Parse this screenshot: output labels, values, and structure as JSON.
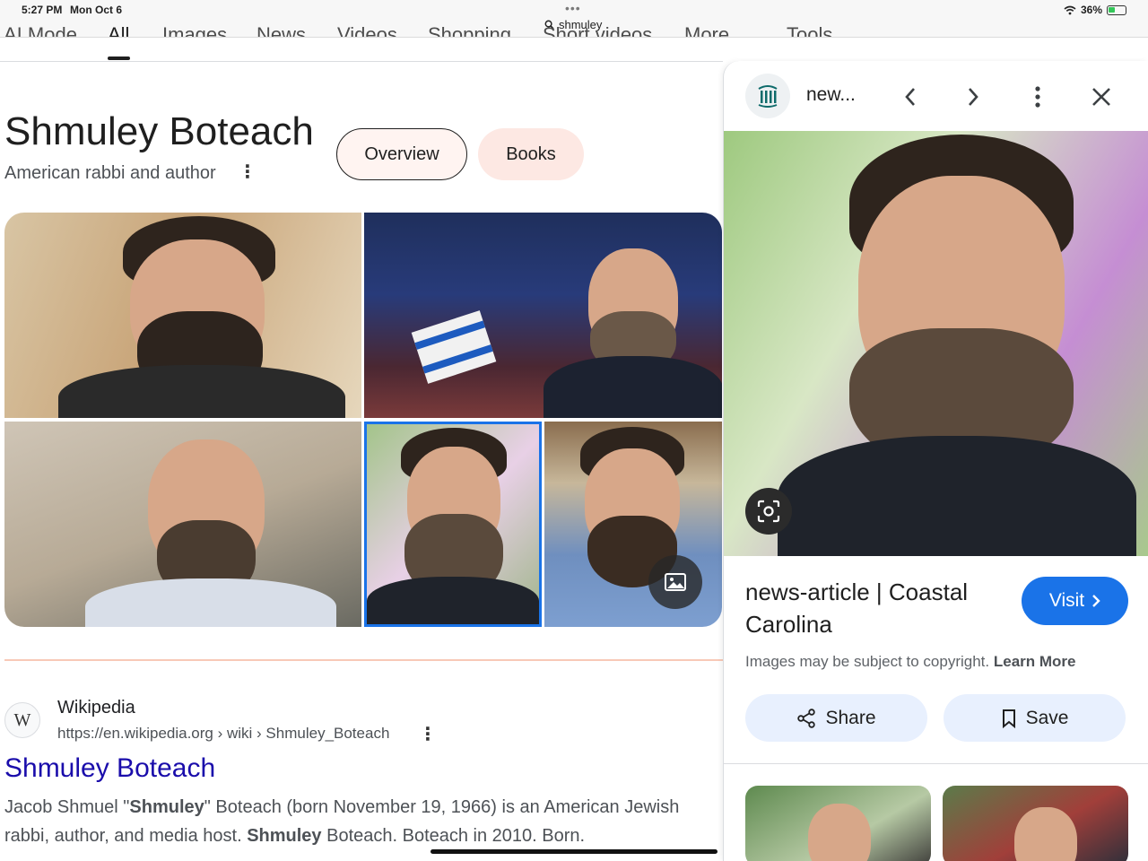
{
  "status_bar": {
    "time": "5:27 PM",
    "date": "Mon Oct 6",
    "url": "shmuley",
    "battery": "36%"
  },
  "search_tabs": [
    {
      "label": "AI Mode"
    },
    {
      "label": "All"
    },
    {
      "label": "Images"
    },
    {
      "label": "News"
    },
    {
      "label": "Videos"
    },
    {
      "label": "Shopping"
    },
    {
      "label": "Short videos"
    },
    {
      "label": "More"
    },
    {
      "label": "Tools"
    }
  ],
  "entity": {
    "title": "Shmuley Boteach",
    "subtitle": "American rabbi and author",
    "chips": [
      {
        "label": "Overview"
      },
      {
        "label": "Books"
      }
    ]
  },
  "result": {
    "source": "Wikipedia",
    "url": "https://en.wikipedia.org › wiki › Shmuley_Boteach",
    "title": "Shmuley Boteach",
    "snippet": {
      "p1": "Jacob Shmuel \"",
      "b1": "Shmuley",
      "p2": "\" Boteach (born November 19, 1966) is an American Jewish rabbi, author, and media host. ",
      "b2": "Shmuley",
      "p3": " Boteach. Boteach in 2010. Born."
    }
  },
  "side_panel": {
    "site_name": "new...",
    "headline": "news-article | Coastal Carolina",
    "visit_label": "Visit",
    "copyright_text": "Images may be subject to copyright.",
    "learn_more": "Learn More",
    "share_label": "Share",
    "save_label": "Save"
  },
  "colors": {
    "link_blue": "#1a0dab",
    "accent_blue": "#1a73e8",
    "chip_background": "#fde8e3",
    "action_button": "#e8f0fe"
  }
}
